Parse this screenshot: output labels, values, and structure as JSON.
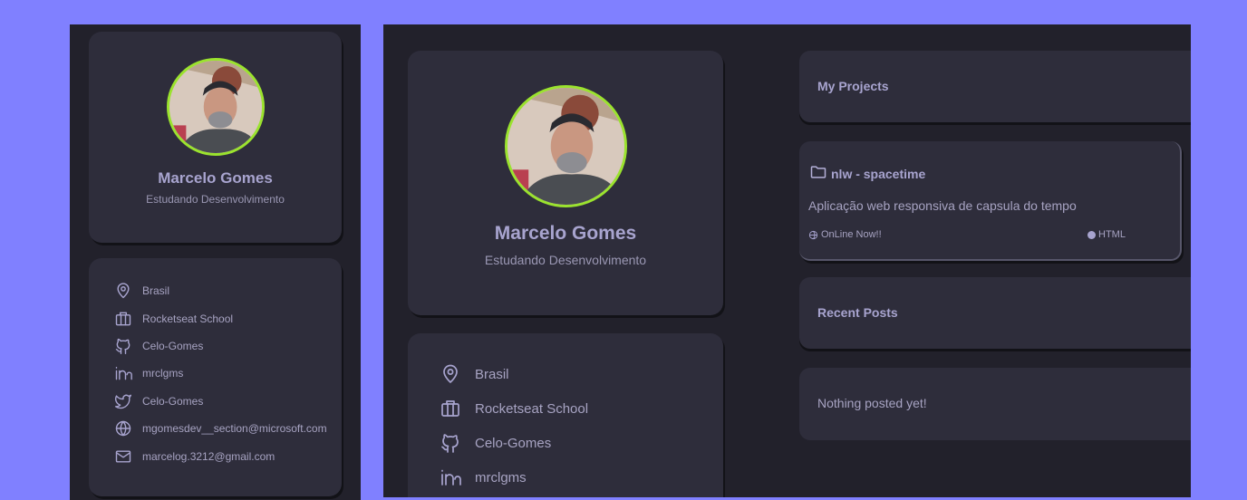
{
  "profile": {
    "name": "Marcelo Gomes",
    "role": "Estudando Desenvolvimento"
  },
  "info": [
    {
      "icon": "location-pin-icon",
      "text": "Brasil"
    },
    {
      "icon": "briefcase-icon",
      "text": "Rocketseat School"
    },
    {
      "icon": "github-icon",
      "text": "Celo-Gomes"
    },
    {
      "icon": "linkedin-icon",
      "text": "mrclgms"
    },
    {
      "icon": "twitter-icon",
      "text": "Celo-Gomes"
    },
    {
      "icon": "globe-icon",
      "text": "mgomesdev__section@microsoft.com"
    },
    {
      "icon": "mail-icon",
      "text": "marcelog.3212@gmail.com"
    }
  ],
  "projects": {
    "title": "My Projects",
    "items": [
      {
        "name": "nlw - spacetime",
        "description": "Aplicação web responsiva de capsula do tempo",
        "status": "OnLine Now!!",
        "language": "HTML"
      }
    ]
  },
  "posts": {
    "title": "Recent Posts",
    "empty_text": "Nothing posted yet!"
  },
  "colors": {
    "background": "#8080ff",
    "panel": "#22212b",
    "card": "#2e2d3b",
    "accent_ring": "#9be32e",
    "text": "#a8a4cf"
  }
}
